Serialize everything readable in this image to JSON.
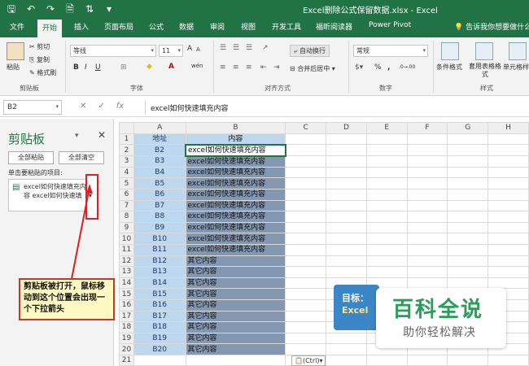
{
  "titlebar": {
    "title": "Excel删除公式保留数据.xlsx  -  Excel",
    "qat": [
      "save-icon",
      "undo-icon",
      "redo-icon",
      "print-preview-icon",
      "sort-icon",
      "customize-icon"
    ],
    "qat_glyphs": [
      "🖫",
      "↶",
      "↷",
      "🗎",
      "⇅",
      "▾"
    ]
  },
  "tabs": [
    "文件",
    "开始",
    "插入",
    "页面布局",
    "公式",
    "数据",
    "审阅",
    "视图",
    "开发工具",
    "福昕阅读器",
    "Power Pivot"
  ],
  "active_tab": "开始",
  "tell_me": "告诉我你想要做什么",
  "ribbon": {
    "clipboard": {
      "paste": "粘贴",
      "cut": "剪切",
      "copy": "复制",
      "format_painter": "格式刷",
      "label": "剪贴板"
    },
    "font": {
      "name": "等线",
      "size": "11",
      "bold": "B",
      "italic": "I",
      "underline": "U",
      "grow": "A",
      "shrink": "A",
      "label": "字体",
      "wen": "wén"
    },
    "alignment": {
      "wrap": "自动换行",
      "merge": "合并后居中",
      "label": "对齐方式"
    },
    "number": {
      "format": "常规",
      "percent": "%",
      "comma": ",",
      "inc": ".0→.00",
      "dec": ".00→.0",
      "label": "数字"
    },
    "styles": {
      "conditional": "条件格式",
      "table": "套用表格格式",
      "cell": "单元格样",
      "label": "样式"
    }
  },
  "formula_bar": {
    "name_box": "B2",
    "cancel": "✕",
    "enter": "✓",
    "fx": "fx",
    "value": "excel如何快速填充内容"
  },
  "clipboard_pane": {
    "title": "剪贴板",
    "paste_all": "全部粘贴",
    "clear_all": "全部清空",
    "hint": "单击要粘贴的项目:",
    "item_line1": "excel如何快速填充内",
    "item_line2": "容 excel如何快速填",
    "item_dropdown": "▾"
  },
  "sheet": {
    "columns": [
      "A",
      "B",
      "C",
      "D",
      "E",
      "F",
      "G",
      "H"
    ],
    "rows": [
      {
        "n": "1",
        "a": "地址",
        "b": "内容"
      },
      {
        "n": "2",
        "a": "B2",
        "b": "excel如何快速填充内容"
      },
      {
        "n": "3",
        "a": "B3",
        "b": "excel如何快速填充内容"
      },
      {
        "n": "4",
        "a": "B4",
        "b": "excel如何快速填充内容"
      },
      {
        "n": "5",
        "a": "B5",
        "b": "excel如何快速填充内容"
      },
      {
        "n": "6",
        "a": "B6",
        "b": "excel如何快速填充内容"
      },
      {
        "n": "7",
        "a": "B7",
        "b": "excel如何快速填充内容"
      },
      {
        "n": "8",
        "a": "B8",
        "b": "excel如何快速填充内容"
      },
      {
        "n": "9",
        "a": "B9",
        "b": "excel如何快速填充内容"
      },
      {
        "n": "10",
        "a": "B10",
        "b": "excel如何快速填充内容"
      },
      {
        "n": "11",
        "a": "B11",
        "b": "excel如何快速填充内容"
      },
      {
        "n": "12",
        "a": "B12",
        "b": "其它内容"
      },
      {
        "n": "13",
        "a": "B13",
        "b": "其它内容"
      },
      {
        "n": "14",
        "a": "B14",
        "b": "其它内容"
      },
      {
        "n": "15",
        "a": "B15",
        "b": "其它内容"
      },
      {
        "n": "16",
        "a": "B16",
        "b": "其它内容"
      },
      {
        "n": "17",
        "a": "B17",
        "b": "其它内容"
      },
      {
        "n": "18",
        "a": "B18",
        "b": "其它内容"
      },
      {
        "n": "19",
        "a": "B19",
        "b": "其它内容"
      },
      {
        "n": "20",
        "a": "B20",
        "b": "其它内容"
      },
      {
        "n": "21",
        "a": "",
        "b": ""
      }
    ]
  },
  "paste_options": "(Ctrl)▾",
  "callout": "剪贴板被打开，鼠标移动到这个位置会出现一个下拉箭头",
  "banner": {
    "line1": "目标：",
    "line2": "Excel"
  },
  "watermark": {
    "line1": "百科全说",
    "line2": "助你轻松解决"
  },
  "colors": {
    "brand": "#217346",
    "callout_border": "#c0392b",
    "selection_fill": "#8497b0",
    "column_a_fill": "#bdd7ee"
  }
}
